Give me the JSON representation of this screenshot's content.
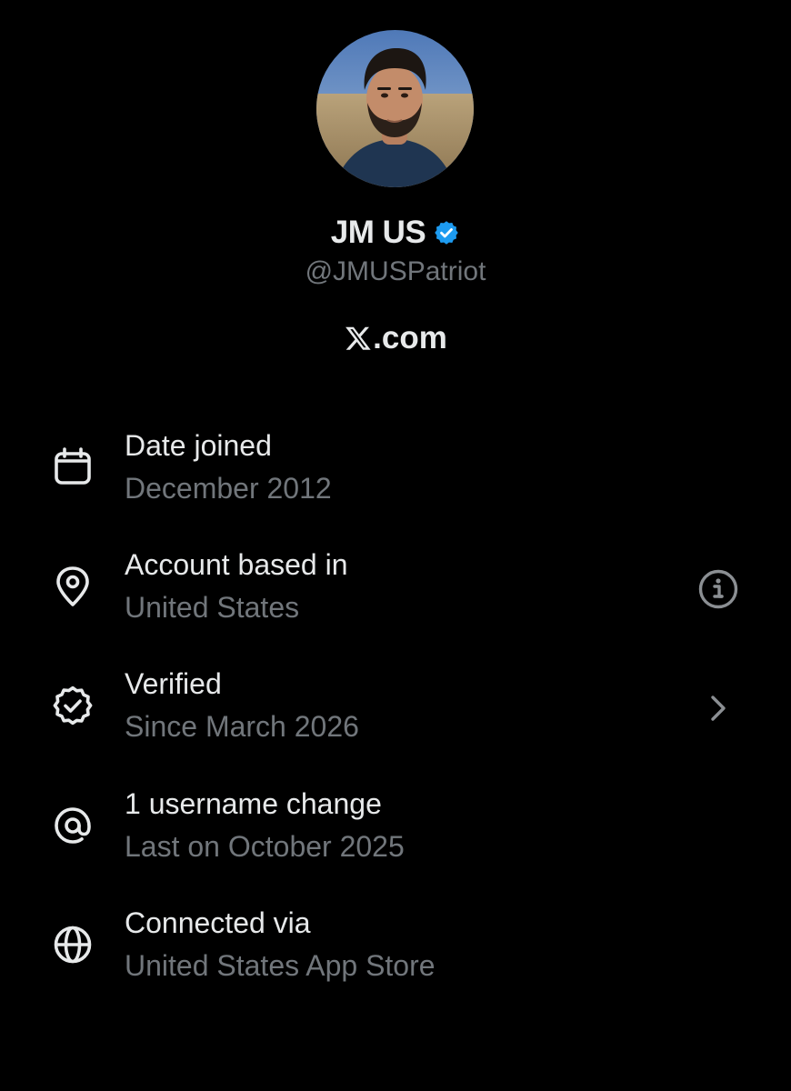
{
  "profile": {
    "name": "JM US",
    "handle": "@JMUSPatriot",
    "verified": true,
    "avatar_alt": "profile photo",
    "site_label": ".com",
    "site_logo_icon": "x-logo-icon"
  },
  "colors": {
    "background": "#000000",
    "primary_text": "#e7e9ea",
    "secondary_text": "#71767b",
    "verified_blue": "#1d9bf0"
  },
  "rows": [
    {
      "icon": "calendar-icon",
      "title": "Date joined",
      "subtitle": "December 2012",
      "trailing": ""
    },
    {
      "icon": "location-pin-icon",
      "title": "Account based in",
      "subtitle": "United States",
      "trailing": "info-icon"
    },
    {
      "icon": "verified-outline-icon",
      "title": "Verified",
      "subtitle": "Since March 2026",
      "trailing": "chevron-right-icon"
    },
    {
      "icon": "at-sign-icon",
      "title": "1 username change",
      "subtitle": "Last on October 2025",
      "trailing": ""
    },
    {
      "icon": "globe-icon",
      "title": "Connected via",
      "subtitle": "United States App Store",
      "trailing": ""
    }
  ]
}
